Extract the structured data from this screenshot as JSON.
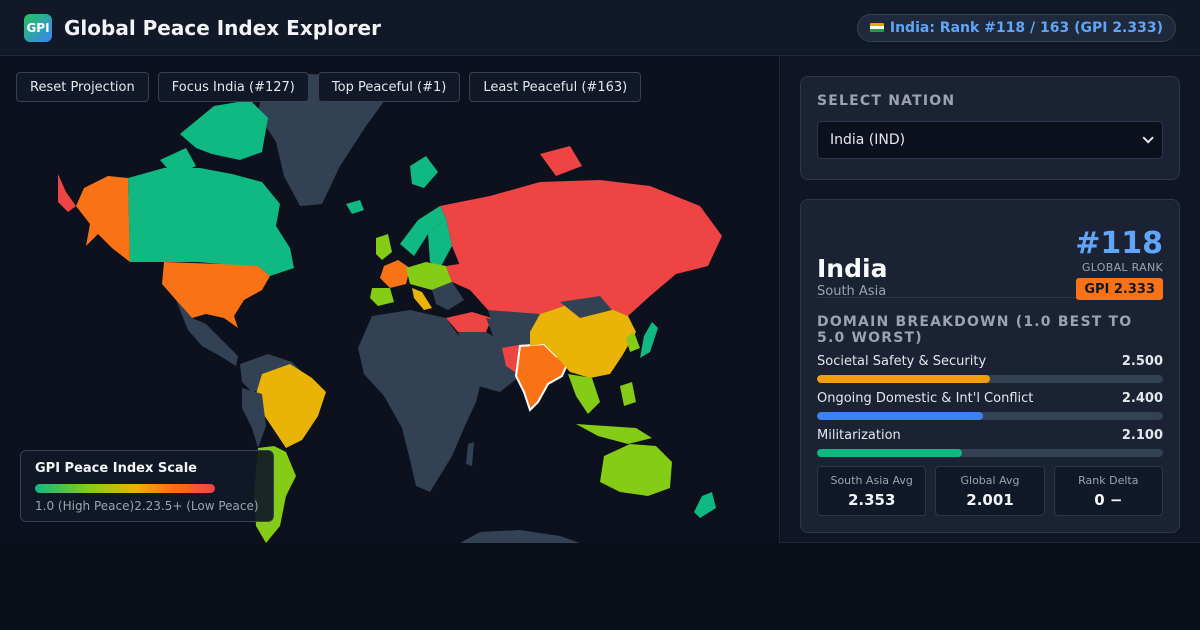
{
  "header": {
    "logo_text": "GPI",
    "title": "Global Peace Index Explorer",
    "badge": "India: Rank #118 / 163 (GPI 2.333)"
  },
  "map": {
    "buttons": {
      "reset": "Reset Projection",
      "focus": "Focus India (#127)",
      "top": "Top Peaceful (#1)",
      "least": "Least Peaceful (#163)"
    },
    "legend": {
      "title": "GPI Peace Index Scale",
      "low": "1.0 (High Peace)",
      "mid": "2.2",
      "high": "3.5+ (Low Peace)"
    },
    "colors": {
      "very_high": "#10b981",
      "high": "#84cc16",
      "medium": "#eab308",
      "low": "#f97316",
      "very_low": "#ef4444",
      "no_data": "#334155",
      "ocean": "#0c111d"
    }
  },
  "panel": {
    "select_label": "SELECT NATION",
    "select_value": "India (IND)",
    "country": "India",
    "region": "South Asia",
    "rank": "#118",
    "rank_label": "GLOBAL RANK",
    "gpi": "GPI 2.333",
    "breakdown_title": "DOMAIN BREAKDOWN (1.0 BEST TO 5.0 WORST)",
    "metrics": [
      {
        "label": "Societal Safety & Security",
        "value": "2.500",
        "fill_pct": 50,
        "color": "#f59e0b"
      },
      {
        "label": "Ongoing Domestic & Int'l Conflict",
        "value": "2.400",
        "fill_pct": 48,
        "color": "#3b82f6"
      },
      {
        "label": "Militarization",
        "value": "2.100",
        "fill_pct": 42,
        "color": "#10b981"
      }
    ],
    "stats": [
      {
        "label": "South Asia Avg",
        "value": "2.353"
      },
      {
        "label": "Global Avg",
        "value": "2.001"
      },
      {
        "label": "Rank Delta",
        "value": "0 −"
      }
    ]
  }
}
